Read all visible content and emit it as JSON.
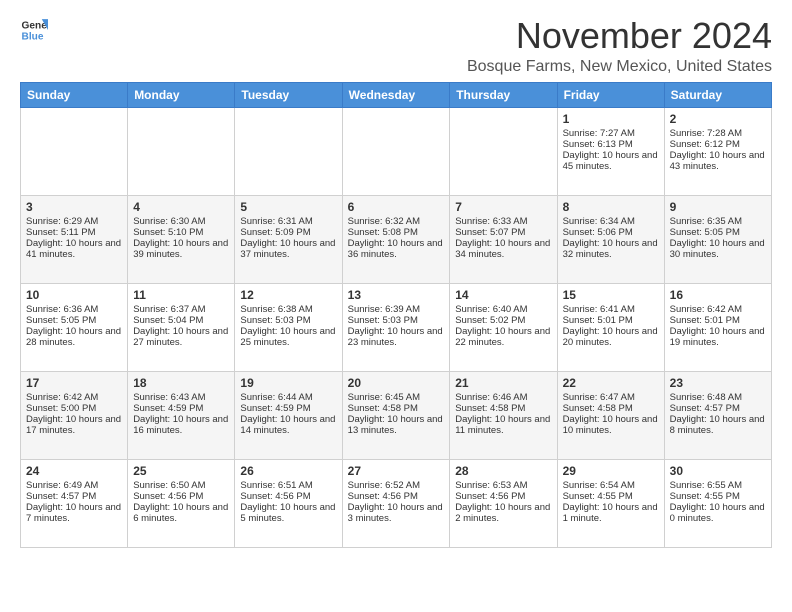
{
  "header": {
    "logo_line1": "General",
    "logo_line2": "Blue",
    "month": "November 2024",
    "location": "Bosque Farms, New Mexico, United States"
  },
  "weekdays": [
    "Sunday",
    "Monday",
    "Tuesday",
    "Wednesday",
    "Thursday",
    "Friday",
    "Saturday"
  ],
  "weeks": [
    [
      {
        "day": "",
        "info": ""
      },
      {
        "day": "",
        "info": ""
      },
      {
        "day": "",
        "info": ""
      },
      {
        "day": "",
        "info": ""
      },
      {
        "day": "",
        "info": ""
      },
      {
        "day": "1",
        "info": "Sunrise: 7:27 AM\nSunset: 6:13 PM\nDaylight: 10 hours and 45 minutes."
      },
      {
        "day": "2",
        "info": "Sunrise: 7:28 AM\nSunset: 6:12 PM\nDaylight: 10 hours and 43 minutes."
      }
    ],
    [
      {
        "day": "3",
        "info": "Sunrise: 6:29 AM\nSunset: 5:11 PM\nDaylight: 10 hours and 41 minutes."
      },
      {
        "day": "4",
        "info": "Sunrise: 6:30 AM\nSunset: 5:10 PM\nDaylight: 10 hours and 39 minutes."
      },
      {
        "day": "5",
        "info": "Sunrise: 6:31 AM\nSunset: 5:09 PM\nDaylight: 10 hours and 37 minutes."
      },
      {
        "day": "6",
        "info": "Sunrise: 6:32 AM\nSunset: 5:08 PM\nDaylight: 10 hours and 36 minutes."
      },
      {
        "day": "7",
        "info": "Sunrise: 6:33 AM\nSunset: 5:07 PM\nDaylight: 10 hours and 34 minutes."
      },
      {
        "day": "8",
        "info": "Sunrise: 6:34 AM\nSunset: 5:06 PM\nDaylight: 10 hours and 32 minutes."
      },
      {
        "day": "9",
        "info": "Sunrise: 6:35 AM\nSunset: 5:05 PM\nDaylight: 10 hours and 30 minutes."
      }
    ],
    [
      {
        "day": "10",
        "info": "Sunrise: 6:36 AM\nSunset: 5:05 PM\nDaylight: 10 hours and 28 minutes."
      },
      {
        "day": "11",
        "info": "Sunrise: 6:37 AM\nSunset: 5:04 PM\nDaylight: 10 hours and 27 minutes."
      },
      {
        "day": "12",
        "info": "Sunrise: 6:38 AM\nSunset: 5:03 PM\nDaylight: 10 hours and 25 minutes."
      },
      {
        "day": "13",
        "info": "Sunrise: 6:39 AM\nSunset: 5:03 PM\nDaylight: 10 hours and 23 minutes."
      },
      {
        "day": "14",
        "info": "Sunrise: 6:40 AM\nSunset: 5:02 PM\nDaylight: 10 hours and 22 minutes."
      },
      {
        "day": "15",
        "info": "Sunrise: 6:41 AM\nSunset: 5:01 PM\nDaylight: 10 hours and 20 minutes."
      },
      {
        "day": "16",
        "info": "Sunrise: 6:42 AM\nSunset: 5:01 PM\nDaylight: 10 hours and 19 minutes."
      }
    ],
    [
      {
        "day": "17",
        "info": "Sunrise: 6:42 AM\nSunset: 5:00 PM\nDaylight: 10 hours and 17 minutes."
      },
      {
        "day": "18",
        "info": "Sunrise: 6:43 AM\nSunset: 4:59 PM\nDaylight: 10 hours and 16 minutes."
      },
      {
        "day": "19",
        "info": "Sunrise: 6:44 AM\nSunset: 4:59 PM\nDaylight: 10 hours and 14 minutes."
      },
      {
        "day": "20",
        "info": "Sunrise: 6:45 AM\nSunset: 4:58 PM\nDaylight: 10 hours and 13 minutes."
      },
      {
        "day": "21",
        "info": "Sunrise: 6:46 AM\nSunset: 4:58 PM\nDaylight: 10 hours and 11 minutes."
      },
      {
        "day": "22",
        "info": "Sunrise: 6:47 AM\nSunset: 4:58 PM\nDaylight: 10 hours and 10 minutes."
      },
      {
        "day": "23",
        "info": "Sunrise: 6:48 AM\nSunset: 4:57 PM\nDaylight: 10 hours and 8 minutes."
      }
    ],
    [
      {
        "day": "24",
        "info": "Sunrise: 6:49 AM\nSunset: 4:57 PM\nDaylight: 10 hours and 7 minutes."
      },
      {
        "day": "25",
        "info": "Sunrise: 6:50 AM\nSunset: 4:56 PM\nDaylight: 10 hours and 6 minutes."
      },
      {
        "day": "26",
        "info": "Sunrise: 6:51 AM\nSunset: 4:56 PM\nDaylight: 10 hours and 5 minutes."
      },
      {
        "day": "27",
        "info": "Sunrise: 6:52 AM\nSunset: 4:56 PM\nDaylight: 10 hours and 3 minutes."
      },
      {
        "day": "28",
        "info": "Sunrise: 6:53 AM\nSunset: 4:56 PM\nDaylight: 10 hours and 2 minutes."
      },
      {
        "day": "29",
        "info": "Sunrise: 6:54 AM\nSunset: 4:55 PM\nDaylight: 10 hours and 1 minute."
      },
      {
        "day": "30",
        "info": "Sunrise: 6:55 AM\nSunset: 4:55 PM\nDaylight: 10 hours and 0 minutes."
      }
    ]
  ]
}
